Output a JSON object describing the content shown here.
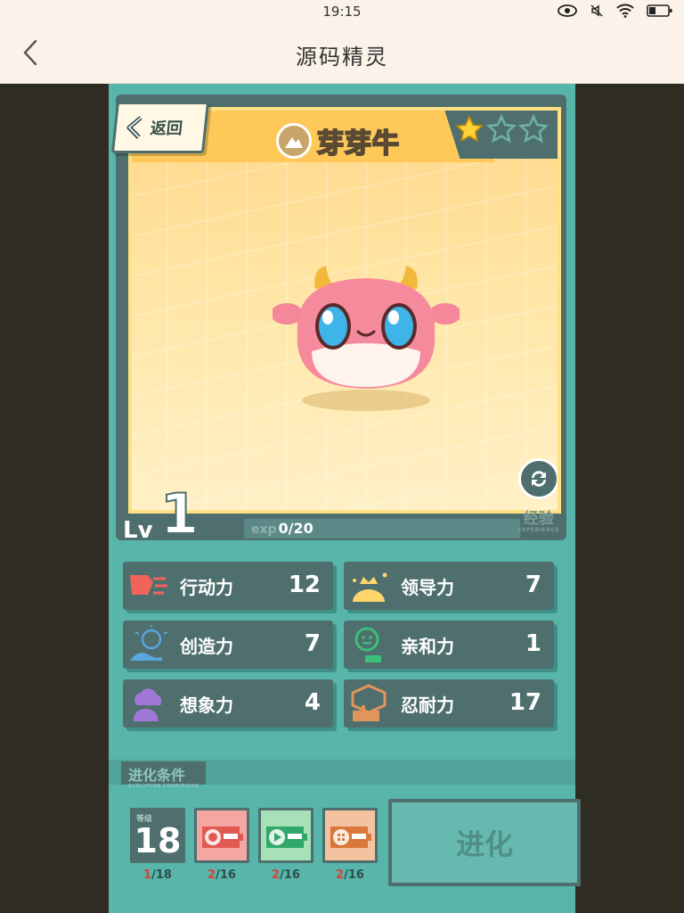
{
  "statusbar": {
    "time": "19:15"
  },
  "nav": {
    "title": "源码精灵"
  },
  "card": {
    "back_label": "返回",
    "sprite_name": "芽芽牛",
    "stars_filled": 1,
    "stars_total": 3,
    "level_label": "Lv",
    "level_value": "1",
    "exp_key": "exp",
    "exp_value": "0/20",
    "exp_current": 0,
    "exp_max": 20,
    "exp_tag": "经验",
    "exp_tag_sub": "EXPERIENCE"
  },
  "stats": [
    {
      "name": "行动力",
      "value": "12",
      "icon": "running-figure-icon",
      "color": "#f2645a"
    },
    {
      "name": "领导力",
      "value": "7",
      "icon": "sunrise-crown-icon",
      "color": "#ffd66b"
    },
    {
      "name": "创造力",
      "value": "7",
      "icon": "lightbulb-icon",
      "color": "#5aa6e0"
    },
    {
      "name": "亲和力",
      "value": "1",
      "icon": "smiling-face-icon",
      "color": "#3bbf7a"
    },
    {
      "name": "想象力",
      "value": "4",
      "icon": "thought-cloud-icon",
      "color": "#a178d8"
    },
    {
      "name": "忍耐力",
      "value": "17",
      "icon": "shield-dumbbell-icon",
      "color": "#e2955a"
    }
  ],
  "evolution": {
    "title": "进化条件",
    "title_sub": "EVOLUTION CONDITIONS",
    "level_tag": "等级",
    "level_required": "18",
    "requirements": [
      {
        "kind": "level",
        "have": "1",
        "need": "/18"
      },
      {
        "kind": "token",
        "icon": "red-token-icon",
        "color": "#f4a7a0",
        "have": "2",
        "need": "/16"
      },
      {
        "kind": "token",
        "icon": "green-token-icon",
        "color": "#a8e0b8",
        "have": "2",
        "need": "/16"
      },
      {
        "kind": "token",
        "icon": "orange-token-icon",
        "color": "#f3c3a0",
        "have": "2",
        "need": "/16"
      }
    ],
    "evolve_label": "进化"
  }
}
